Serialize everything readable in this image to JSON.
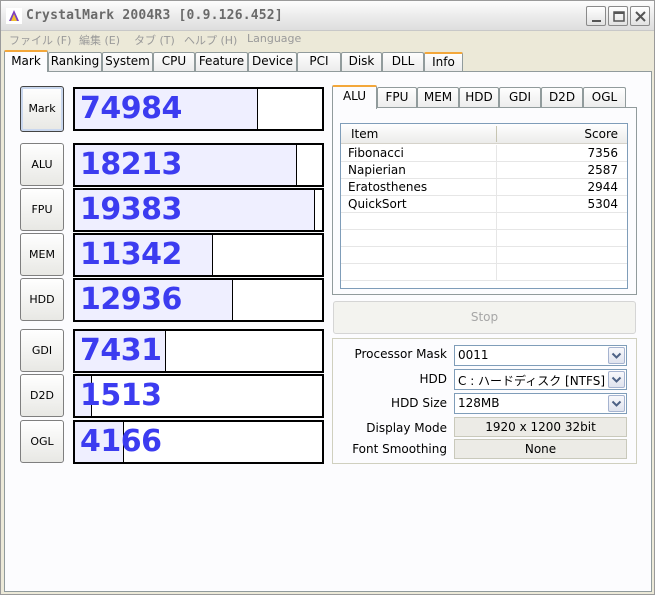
{
  "window": {
    "title": "CrystalMark 2004R3 [0.9.126.452]"
  },
  "menu": [
    "ファイル (F)",
    "編集 (E)",
    "タブ (T)",
    "ヘルプ (H)",
    "Language"
  ],
  "main_tabs": [
    "Mark",
    "Ranking",
    "System",
    "CPU",
    "Feature",
    "Device",
    "PCI",
    "Disk",
    "DLL",
    "Info"
  ],
  "active_main_tab": "Mark",
  "scores": [
    {
      "label": "Mark",
      "value": "74984",
      "fill_fraction": 0.74
    },
    {
      "label": "ALU",
      "value": "18213",
      "fill_fraction": 0.9
    },
    {
      "label": "FPU",
      "value": "19383",
      "fill_fraction": 0.97
    },
    {
      "label": "MEM",
      "value": "11342",
      "fill_fraction": 0.56
    },
    {
      "label": "HDD",
      "value": "12936",
      "fill_fraction": 0.64
    },
    {
      "label": "GDI",
      "value": "7431",
      "fill_fraction": 0.37
    },
    {
      "label": "D2D",
      "value": "1513",
      "fill_fraction": 0.07
    },
    {
      "label": "OGL",
      "value": "4166",
      "fill_fraction": 0.2
    }
  ],
  "sub_tabs": [
    "ALU",
    "FPU",
    "MEM",
    "HDD",
    "GDI",
    "D2D",
    "OGL"
  ],
  "active_sub_tab": "ALU",
  "detail_list": {
    "headers": {
      "item": "Item",
      "score": "Score"
    },
    "rows": [
      {
        "item": "Fibonacci",
        "score": "7356"
      },
      {
        "item": "Napierian",
        "score": "2587"
      },
      {
        "item": "Eratosthenes",
        "score": "2944"
      },
      {
        "item": "QuickSort",
        "score": "5304"
      }
    ]
  },
  "stop_button": "Stop",
  "settings": {
    "processor_mask": {
      "label": "Processor Mask",
      "value": "0011"
    },
    "hdd": {
      "label": "HDD",
      "value": "C : ハードディスク [NTFS]"
    },
    "hdd_size": {
      "label": "HDD Size",
      "value": "128MB"
    },
    "display_mode": {
      "label": "Display Mode",
      "value": "1920 x 1200 32bit"
    },
    "font_smoothing": {
      "label": "Font Smoothing",
      "value": "None"
    }
  },
  "colors": {
    "score_text": "#3c3cf0",
    "bar_fill": "#efefff",
    "tab_accent": "#f3a73a"
  }
}
